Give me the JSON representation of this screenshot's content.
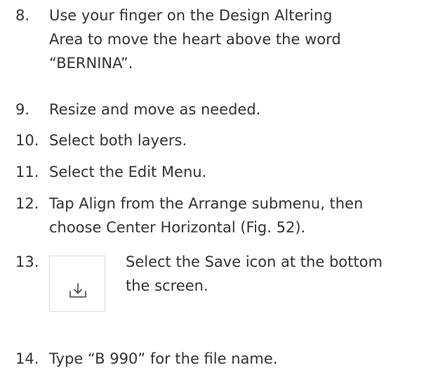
{
  "steps": [
    {
      "number": "8.",
      "lines": [
        "Use your finger on the Design Altering",
        "Area to move the heart above the word",
        "“BERNINA”."
      ]
    },
    {
      "number": "9.",
      "lines": [
        "Resize and move as needed."
      ]
    },
    {
      "number": "10.",
      "lines": [
        "Select both layers."
      ]
    },
    {
      "number": "11.",
      "lines": [
        "Select the Edit Menu."
      ]
    },
    {
      "number": "12.",
      "lines": [
        "Tap Align from the Arrange submenu, then",
        "choose Center Horizontal (Fig. 52)."
      ]
    },
    {
      "number": "13.",
      "icon": "save-download-icon",
      "lines": [
        "Select the Save icon at the bottom",
        "the screen."
      ]
    },
    {
      "number": "14.",
      "lines": [
        "Type “B 990” for the file name."
      ]
    }
  ]
}
